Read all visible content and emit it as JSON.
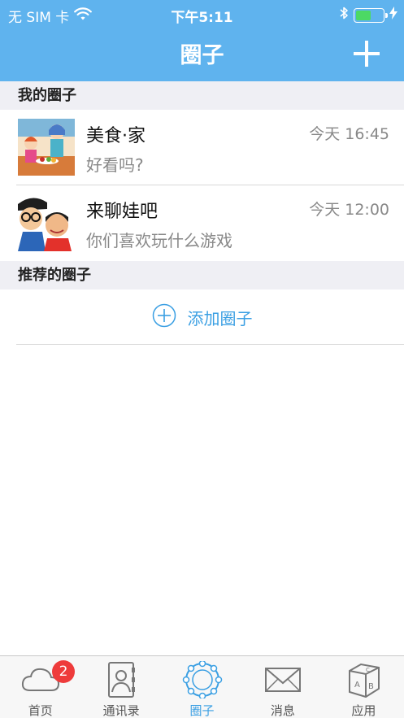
{
  "status_bar": {
    "carrier": "无 SIM 卡",
    "time": "下午5:11",
    "battery_level": 0.6
  },
  "nav": {
    "title": "圈子"
  },
  "sections": {
    "mine": "我的圈子",
    "recommended": "推荐的圈子"
  },
  "circles": [
    {
      "name": "美食·家",
      "last_message": "好看吗?",
      "time": "今天 16:45"
    },
    {
      "name": "来聊娃吧",
      "last_message": "你们喜欢玩什么游戏",
      "time": "今天 12:00"
    }
  ],
  "add_circle": {
    "label": "添加圈子"
  },
  "tabs": [
    {
      "label": "首页",
      "badge": "2",
      "icon": "cloud-icon"
    },
    {
      "label": "通讯录",
      "icon": "contacts-book-icon"
    },
    {
      "label": "圈子",
      "icon": "circle-network-icon"
    },
    {
      "label": "消息",
      "icon": "envelope-icon"
    },
    {
      "label": "应用",
      "icon": "abc-cube-icon"
    }
  ],
  "colors": {
    "header": "#5fb3ee",
    "accent": "#3a9fe3",
    "badge": "#ee3b3b"
  }
}
